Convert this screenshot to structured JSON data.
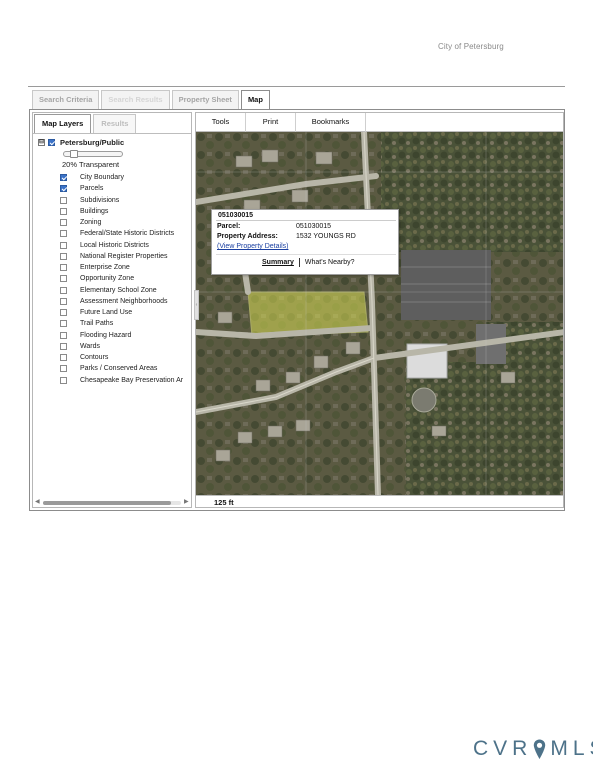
{
  "header": {
    "city_title": "City of Petersburg"
  },
  "main_tabs": [
    {
      "label": "Search Criteria",
      "state": "inactive"
    },
    {
      "label": "Search Results",
      "state": "faded"
    },
    {
      "label": "Property Sheet",
      "state": "inactive"
    },
    {
      "label": "Map",
      "state": "active"
    }
  ],
  "left_panel": {
    "tabs": [
      {
        "label": "Map Layers",
        "active": true
      },
      {
        "label": "Results",
        "active": false
      }
    ],
    "root_layer": {
      "expander": "⊟",
      "label": "Petersburg/Public",
      "checked": true
    },
    "transparency_label": "20% Transparent",
    "transparency_percent": 20,
    "layers": [
      {
        "label": "City Boundary",
        "checked": true
      },
      {
        "label": "Parcels",
        "checked": true
      },
      {
        "label": "Subdivisions",
        "checked": false
      },
      {
        "label": "Buildings",
        "checked": false
      },
      {
        "label": "Zoning",
        "checked": false
      },
      {
        "label": "Federal/State Historic Districts",
        "checked": false
      },
      {
        "label": "Local Historic Districts",
        "checked": false
      },
      {
        "label": "National Register Properties",
        "checked": false
      },
      {
        "label": "Enterprise Zone",
        "checked": false
      },
      {
        "label": "Opportunity Zone",
        "checked": false
      },
      {
        "label": "Elementary School Zone",
        "checked": false
      },
      {
        "label": "Assessment Neighborhoods",
        "checked": false
      },
      {
        "label": "Future Land Use",
        "checked": false
      },
      {
        "label": "Trail Paths",
        "checked": false
      },
      {
        "label": "Flooding Hazard",
        "checked": false
      },
      {
        "label": "Wards",
        "checked": false
      },
      {
        "label": "Contours",
        "checked": false
      },
      {
        "label": "Parks / Conserved Areas",
        "checked": false
      },
      {
        "label": "Chesapeake Bay Preservation Ar",
        "checked": false
      }
    ]
  },
  "map_toolbar": {
    "tools": "Tools",
    "print": "Print",
    "bookmarks": "Bookmarks"
  },
  "popup": {
    "title": "051030015",
    "parcel_label": "Parcel:",
    "parcel_value": "051030015",
    "address_label": "Property Address:",
    "address_value": "1532  YOUNGS RD",
    "details_link": "(View Property Details)",
    "tab_summary": "Summary",
    "tab_nearby": "What's Nearby?"
  },
  "scale": {
    "label": "125 ft"
  },
  "footer": {
    "brand_left": "CVR",
    "brand_right": "MLS"
  },
  "colors": {
    "checkbox_checked": "#3b73c8",
    "link": "#1a3fa0",
    "brand": "#4d7289",
    "parcel_highlight": "#e3e86a"
  },
  "icons": {
    "expander": "minus-box-icon",
    "map_pin": "map-pin-icon",
    "scroll_left": "arrow-left-icon",
    "scroll_right": "arrow-right-icon"
  }
}
